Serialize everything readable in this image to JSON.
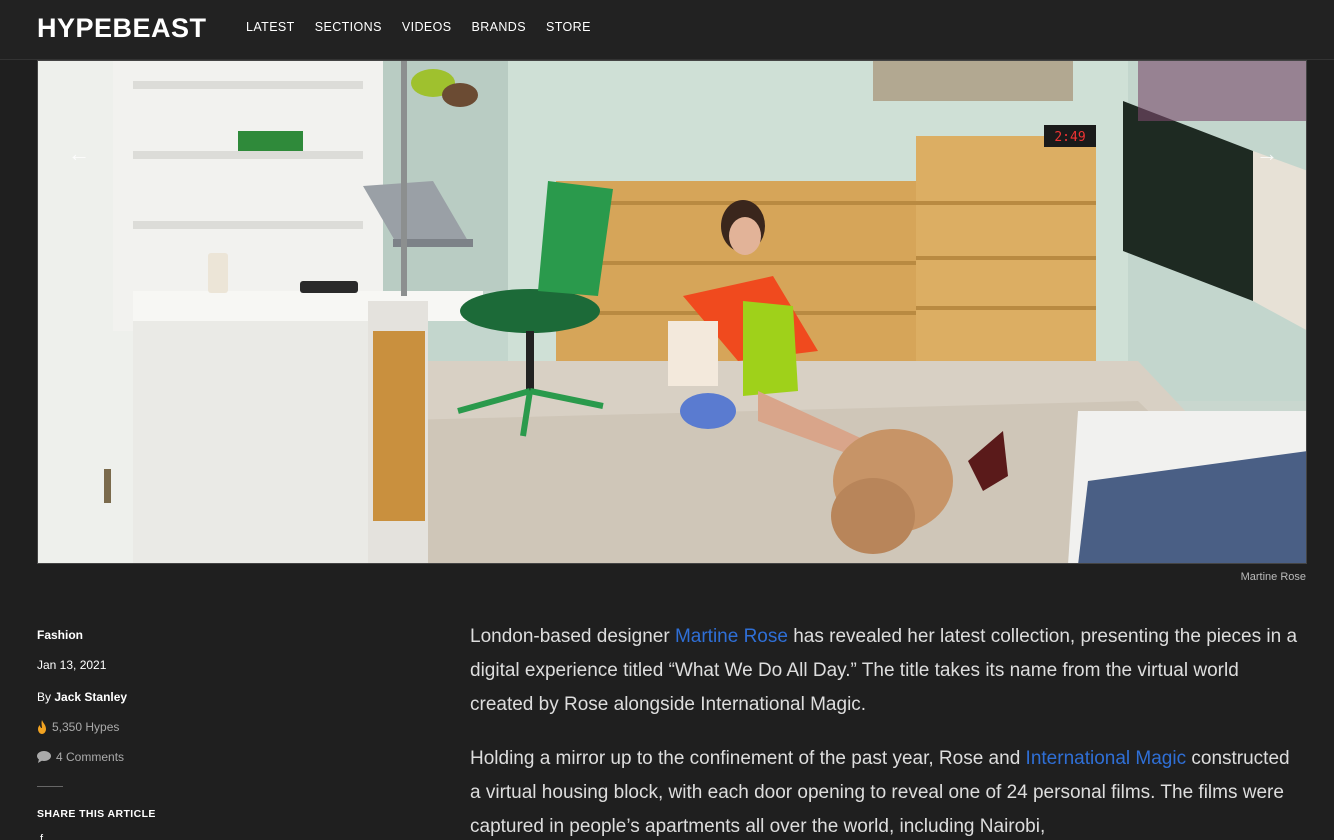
{
  "header": {
    "logo": "HYPEBEAST",
    "nav": [
      "LATEST",
      "SECTIONS",
      "VIDEOS",
      "BRANDS",
      "STORE"
    ]
  },
  "hero": {
    "caption": "Martine Rose",
    "clock": "2:49"
  },
  "meta": {
    "category": "Fashion",
    "date": "Jan 13, 2021",
    "author_prefix": "By",
    "author": "Jack Stanley",
    "hypes": "5,350 Hypes",
    "comments": "4 Comments",
    "share_label": "SHARE THIS ARTICLE"
  },
  "article": {
    "p1_pre": "London-based designer ",
    "p1_link": "Martine Rose",
    "p1_post": " has revealed her latest collection, presenting the pieces in a digital experience titled “What We Do All Day.” The title takes its name from the virtual world created by Rose alongside International Magic.",
    "p2_pre": "Holding a mirror up to the confinement of the past year, Rose and ",
    "p2_link": "International Magic",
    "p2_post": " constructed a virtual housing block, with each door opening to reveal one of 24 personal films. The films were captured in people’s apartments all over the world, including Nairobi,"
  },
  "colors": {
    "background": "#1f1f1f",
    "link": "#2f6fd6"
  }
}
